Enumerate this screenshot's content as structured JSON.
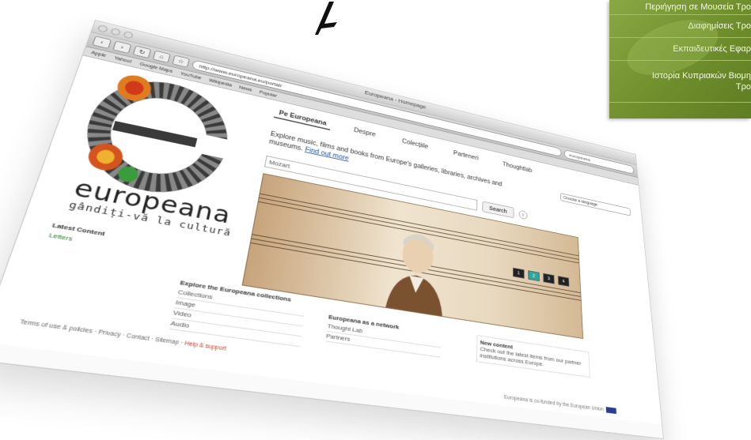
{
  "side_menu": {
    "items": [
      {
        "label": "Περιήγηση σε Μουσεία Τρο"
      },
      {
        "label": "Διαφημίσεις Τρο"
      },
      {
        "label": "Εκπαιδευτικές Εφαρ"
      },
      {
        "label": "Ιστορία Κυπριακών Βιομη",
        "label2": "Τρο"
      }
    ]
  },
  "browser": {
    "title": "Europeana - Homepage",
    "url": "http://www.europeana.eu/portal/",
    "search_placeholder": "europeana",
    "bookmarks": [
      "Apple",
      "Yahoo!",
      "Google Maps",
      "YouTube",
      "Wikipedia",
      "News",
      "Popular"
    ]
  },
  "page": {
    "logo_word": "europeana",
    "logo_tagline": "gândiți-vă la cultură",
    "tabs": [
      "Pe Europeana",
      "Despre",
      "Colecțiile",
      "Parteneri",
      "Thoughtlab"
    ],
    "language_select": "Choose a language",
    "intro_text": "Explore music, films and books from Europe's galleries, libraries, archives and museums.",
    "intro_link": "Find out more",
    "search_value": "Mozart",
    "search_button": "Search",
    "help_icon": "?",
    "hero_controls": [
      "1",
      "2",
      "3",
      "4"
    ],
    "sidebox_title": "Latest Content",
    "sidebox_item": "Letters",
    "col1_title": "Explore the Europeana collections",
    "col1_lines": [
      "Collections",
      "Image",
      "Video",
      "Audio"
    ],
    "col2_title": "Europeana as a network",
    "col2_lines": [
      "Thought Lab",
      "Partners"
    ],
    "news_title": "New content",
    "news_text": "Check out the latest items from our partner institutions across Europe.",
    "footer_text": "Terms of use & policies · Privacy · Contact · Sitemap ·",
    "footer_red": "Help & support",
    "partner_text": "Europeana is co-funded by the European Union"
  }
}
